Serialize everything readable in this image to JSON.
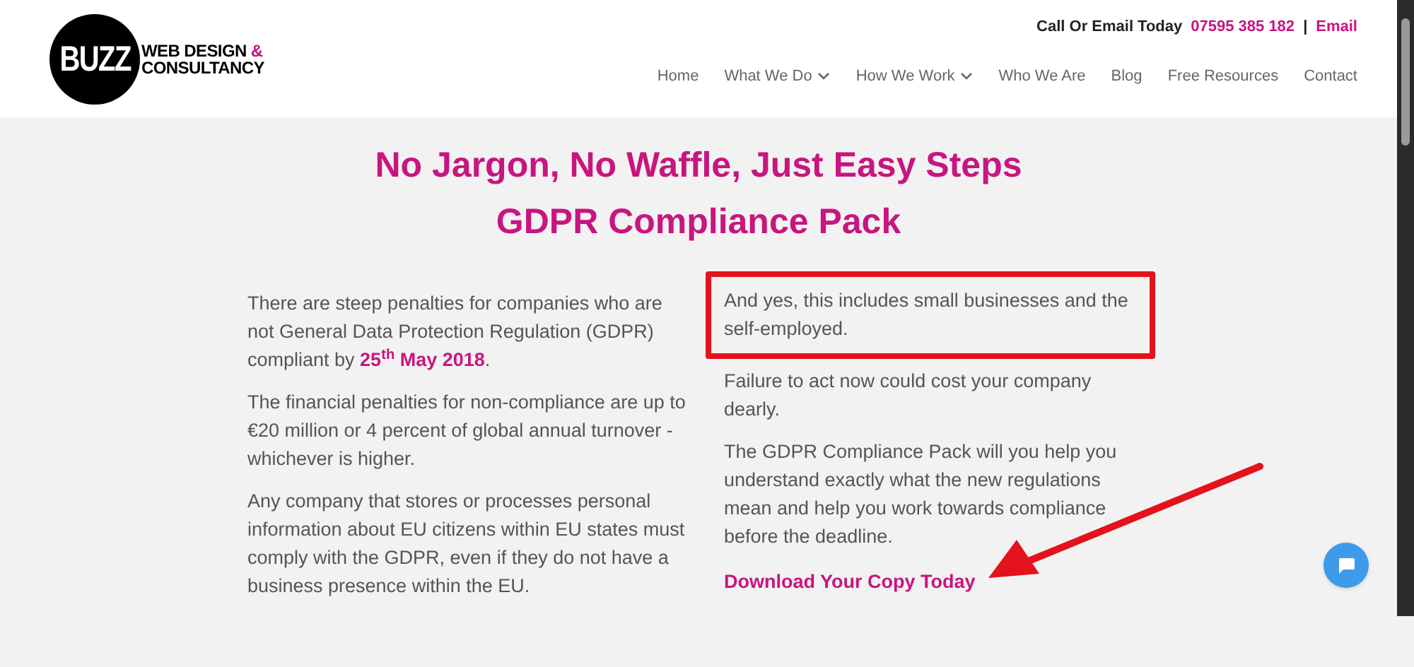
{
  "header": {
    "logo": {
      "mark": "BUZZ",
      "line_1": "WEB DESIGN",
      "ampersand": "&",
      "line_2": "CONSULTANCY"
    },
    "contact": {
      "label": "Call Or Email Today",
      "phone": "07595 385 182",
      "separator": "|",
      "email": "Email"
    },
    "nav": [
      {
        "label": "Home",
        "dropdown": false
      },
      {
        "label": "What We Do",
        "dropdown": true
      },
      {
        "label": "How We Work",
        "dropdown": true
      },
      {
        "label": "Who We Are",
        "dropdown": false
      },
      {
        "label": "Blog",
        "dropdown": false
      },
      {
        "label": "Free Resources",
        "dropdown": false
      },
      {
        "label": "Contact",
        "dropdown": false
      }
    ]
  },
  "main": {
    "headings": [
      "No Jargon, No Waffle, Just Easy Steps",
      "GDPR Compliance Pack"
    ],
    "left_column": [
      "There are steep penalties for companies who are not General Data Protection Regulation (GDPR) compliant by **25$^{th}$ May 2018**.",
      "The financial penalties for non-compliance are up to €20 million or 4 percent of global annual turnover - whichever is higher.",
      "Any company that stores or processes personal information about EU citizens within EU states must comply with the GDPR, even if they do not have a business presence within the EU."
    ],
    "right_column": [
      {
        "text": "And yes, this includes small businesses and the self-employed.",
        "highlighted": true
      },
      {
        "text": "Failure to act now could cost your company dearly.",
        "highlighted": false
      },
      {
        "text": "The GDPR Compliance Pack will you help you understand exactly what the new regulations mean and help you work towards compliance before the deadline.",
        "highlighted": false
      }
    ],
    "cta_link": "Download Your Copy Today"
  }
}
